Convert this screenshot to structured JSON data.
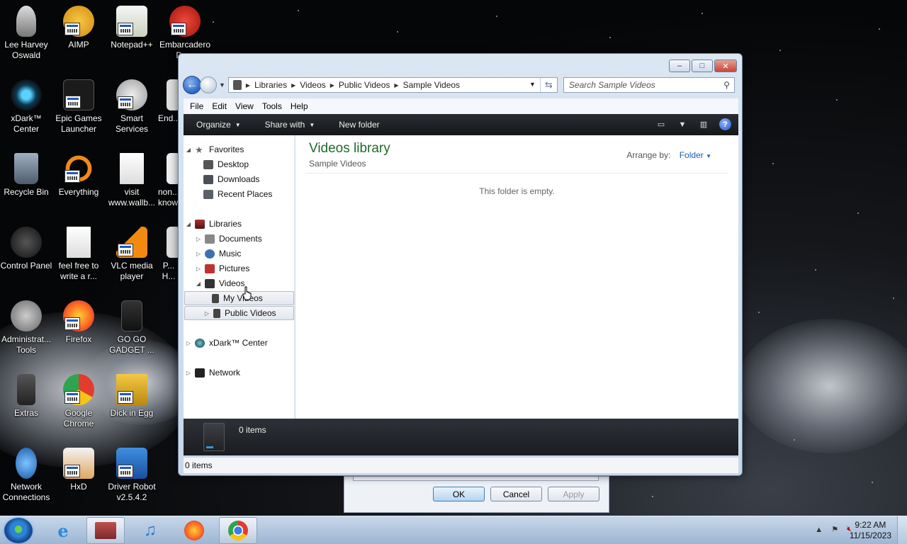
{
  "desktop": {
    "icons": [
      {
        "label": "Lee Harvey Oswald",
        "icon": "person-icon"
      },
      {
        "label": "AIMP",
        "icon": "aimp-icon"
      },
      {
        "label": "Notepad++",
        "icon": "notepad-icon"
      },
      {
        "label": "Embarcadero De...",
        "icon": "embarcadero-icon"
      },
      {
        "label": "xDark™ Center",
        "icon": "xdark-icon"
      },
      {
        "label": "Epic Games Launcher",
        "icon": "epic-icon"
      },
      {
        "label": "Smart Services",
        "icon": "gear-icon"
      },
      {
        "label": "End...",
        "icon": "app-icon"
      },
      {
        "label": "Recycle Bin",
        "icon": "recycle-bin-icon"
      },
      {
        "label": "Everything",
        "icon": "search-app-icon"
      },
      {
        "label": "visit www.wallb...",
        "icon": "document-icon"
      },
      {
        "label": "non... know...",
        "icon": "document-icon"
      },
      {
        "label": "Control Panel",
        "icon": "control-panel-icon"
      },
      {
        "label": "feel free to write a r...",
        "icon": "document-icon"
      },
      {
        "label": "VLC media player",
        "icon": "vlc-icon"
      },
      {
        "label": "P... H...",
        "icon": "app-icon"
      },
      {
        "label": "Administrat... Tools",
        "icon": "admin-tools-icon"
      },
      {
        "label": "Firefox",
        "icon": "firefox-icon"
      },
      {
        "label": "GO GO GADGET ...",
        "icon": "gadget-icon"
      },
      {
        "label": "Extras",
        "icon": "folder-icon"
      },
      {
        "label": "Google Chrome",
        "icon": "chrome-icon"
      },
      {
        "label": "Dick in Egg",
        "icon": "app-icon"
      },
      {
        "label": "Network Connections",
        "icon": "network-icon"
      },
      {
        "label": "HxD",
        "icon": "hex-editor-icon"
      },
      {
        "label": "Driver Robot v2.5.4.2",
        "icon": "driver-robot-icon"
      }
    ]
  },
  "window": {
    "controls": {
      "minimize": "–",
      "maximize": "□",
      "close": "✕"
    },
    "address": {
      "crumbs": [
        "Libraries",
        "Videos",
        "Public Videos",
        "Sample Videos"
      ]
    },
    "search": {
      "placeholder": "Search Sample Videos"
    },
    "menu": [
      "File",
      "Edit",
      "View",
      "Tools",
      "Help"
    ],
    "toolbar": {
      "organize": "Organize",
      "share": "Share with",
      "new_folder": "New folder"
    },
    "tree": {
      "favorites": "Favorites",
      "desktop": "Desktop",
      "downloads": "Downloads",
      "recent": "Recent Places",
      "libraries": "Libraries",
      "documents": "Documents",
      "music": "Music",
      "pictures": "Pictures",
      "videos": "Videos",
      "my_videos": "My Videos",
      "public_videos": "Public Videos",
      "xdark": "xDark™ Center",
      "network": "Network"
    },
    "content": {
      "title": "Videos library",
      "subtitle": "Sample Videos",
      "arrange_label": "Arrange by:",
      "arrange_value": "Folder",
      "empty_msg": "This folder is empty."
    },
    "details": {
      "count": "0 items"
    },
    "status": {
      "count": "0 items"
    }
  },
  "dialog": {
    "ok": "OK",
    "cancel": "Cancel",
    "apply": "Apply"
  },
  "taskbar": {
    "apps": [
      "ie-icon",
      "explorer-icon",
      "itunes-icon",
      "firefox-icon",
      "chrome-icon"
    ],
    "time": "9:22 AM",
    "date": "11/15/2023"
  }
}
